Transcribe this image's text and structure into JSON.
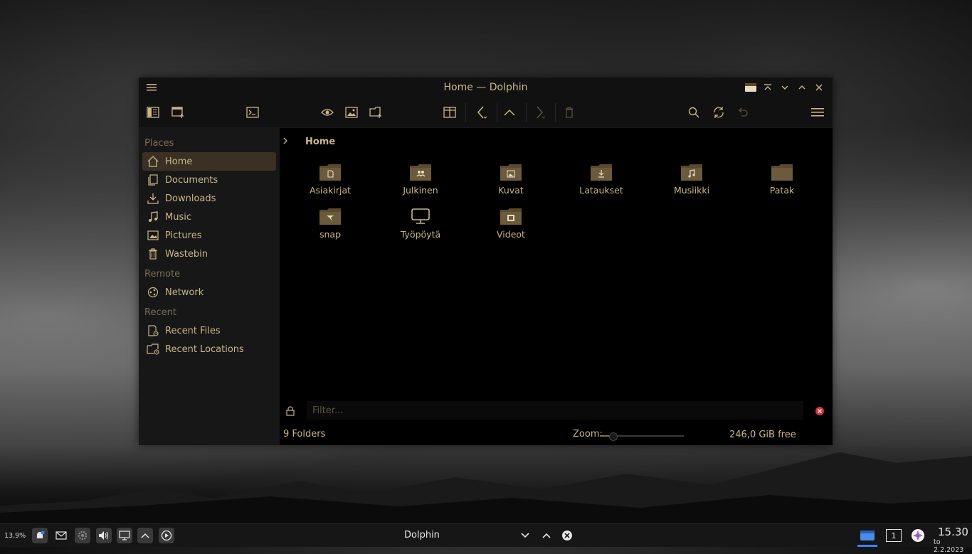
{
  "window": {
    "title": "Home — Dolphin",
    "accent_color": "#c9b68a",
    "selection_color": "#3a3124"
  },
  "sidebar": {
    "sections": [
      {
        "title": "Places",
        "items": [
          {
            "label": "Home",
            "icon": "home-icon",
            "active": true
          },
          {
            "label": "Documents",
            "icon": "documents-icon"
          },
          {
            "label": "Downloads",
            "icon": "downloads-icon"
          },
          {
            "label": "Music",
            "icon": "music-icon"
          },
          {
            "label": "Pictures",
            "icon": "pictures-icon"
          },
          {
            "label": "Wastebin",
            "icon": "trash-icon"
          }
        ]
      },
      {
        "title": "Remote",
        "items": [
          {
            "label": "Network",
            "icon": "network-icon"
          }
        ]
      },
      {
        "title": "Recent",
        "items": [
          {
            "label": "Recent Files",
            "icon": "recent-files-icon"
          },
          {
            "label": "Recent Locations",
            "icon": "recent-locations-icon"
          }
        ]
      }
    ]
  },
  "breadcrumb": {
    "current": "Home"
  },
  "files": [
    {
      "name": "Asiakirjat",
      "emblem": "document-emblem"
    },
    {
      "name": "Julkinen",
      "emblem": "users-emblem"
    },
    {
      "name": "Kuvat",
      "emblem": "image-emblem"
    },
    {
      "name": "Lataukset",
      "emblem": "download-emblem"
    },
    {
      "name": "Musiikki",
      "emblem": "music-emblem"
    },
    {
      "name": "Patak",
      "emblem": "none"
    },
    {
      "name": "snap",
      "emblem": "snap-emblem"
    },
    {
      "name": "Työpöytä",
      "emblem": "desktop-monitor"
    },
    {
      "name": "Videot",
      "emblem": "video-emblem"
    }
  ],
  "filter": {
    "placeholder": "Filter..."
  },
  "status": {
    "folder_count": "9 Folders",
    "zoom_label": "Zoom:",
    "zoom_level": 0.15,
    "free_space": "246,0 GiB free"
  },
  "taskbar": {
    "cpu": "13,9%",
    "task_title": "Dolphin",
    "virtual_desktop": "1",
    "time": "15.30",
    "date": "to 2.2.2023"
  }
}
